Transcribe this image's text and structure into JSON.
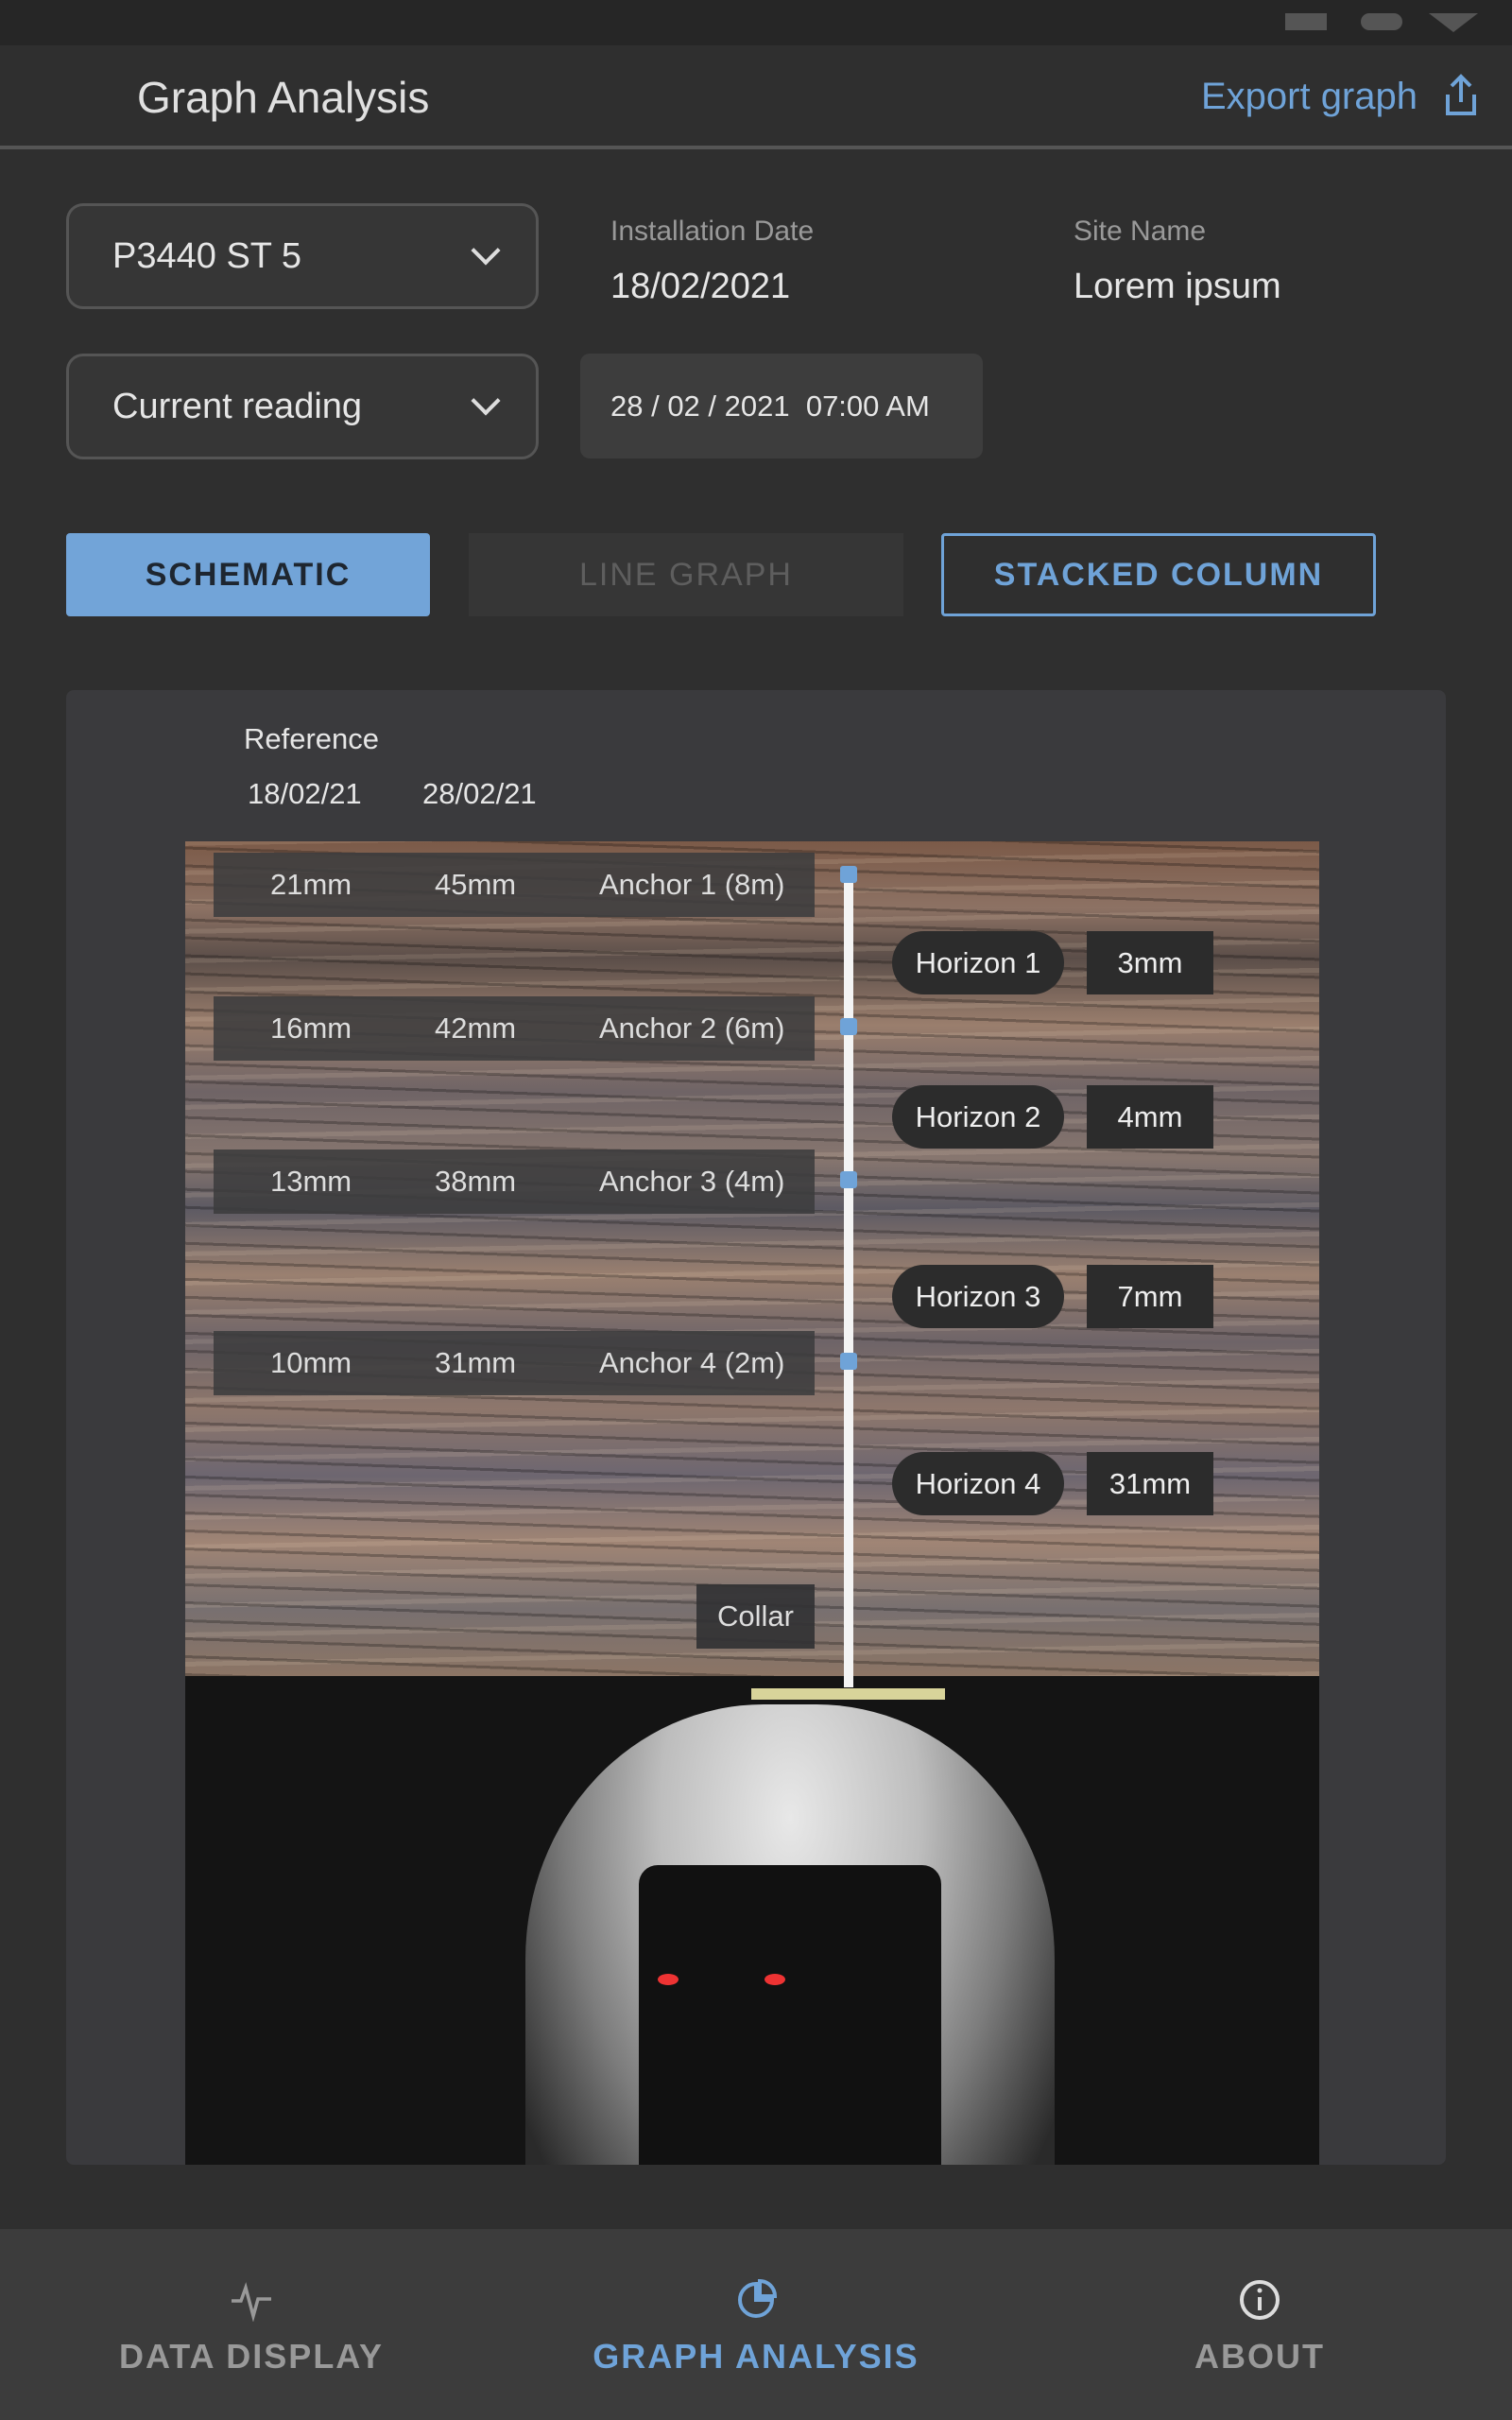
{
  "header": {
    "title": "Graph Analysis",
    "export_label": "Export graph"
  },
  "controls": {
    "instrument_select": "P3440 ST 5",
    "reading_select": "Current reading",
    "installation_date_label": "Installation Date",
    "installation_date": "18/02/2021",
    "site_name_label": "Site Name",
    "site_name": "Lorem ipsum",
    "reading_datetime": "28 / 02 / 2021  07:00 AM"
  },
  "view_tabs": [
    {
      "label": "SCHEMATIC",
      "state": "active"
    },
    {
      "label": "LINE GRAPH",
      "state": "disabled"
    },
    {
      "label": "STACKED COLUMN",
      "state": "outlined"
    }
  ],
  "schematic": {
    "reference_label": "Reference",
    "date_reference": "18/02/21",
    "date_current": "28/02/21",
    "anchors": [
      {
        "reference": "21mm",
        "current": "45mm",
        "label": "Anchor 1 (8m)"
      },
      {
        "reference": "16mm",
        "current": "42mm",
        "label": "Anchor 2 (6m)"
      },
      {
        "reference": "13mm",
        "current": "38mm",
        "label": "Anchor 3 (4m)"
      },
      {
        "reference": "10mm",
        "current": "31mm",
        "label": "Anchor 4 (2m)"
      }
    ],
    "horizons": [
      {
        "label": "Horizon 1",
        "value": "3mm"
      },
      {
        "label": "Horizon 2",
        "value": "4mm"
      },
      {
        "label": "Horizon 3",
        "value": "7mm"
      },
      {
        "label": "Horizon 4",
        "value": "31mm"
      }
    ],
    "collar_label": "Collar"
  },
  "nav": [
    {
      "label": "DATA DISPLAY",
      "icon": "pulse-icon"
    },
    {
      "label": "GRAPH ANALYSIS",
      "icon": "pie-chart-icon",
      "active": true
    },
    {
      "label": "ABOUT",
      "icon": "info-icon"
    }
  ],
  "colors": {
    "accent": "#6fa3d8",
    "background": "#2f2f2f",
    "panel": "#3a3a3d"
  }
}
